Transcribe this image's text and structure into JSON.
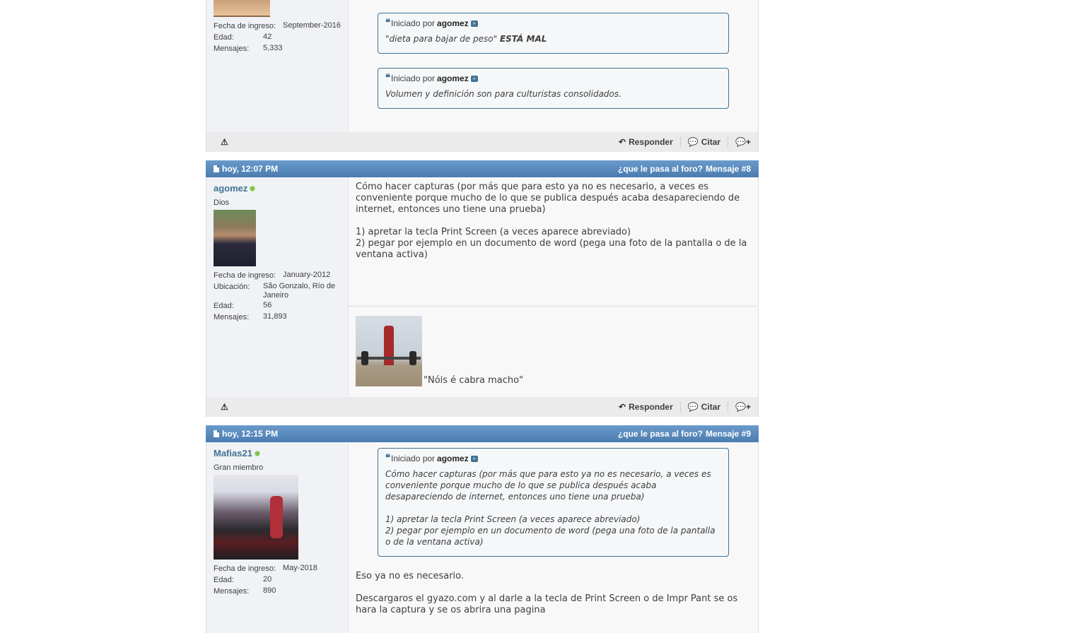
{
  "post7": {
    "user_stats": [
      {
        "label": "Fecha de ingreso:",
        "value": "September-2016"
      },
      {
        "label": "Edad:",
        "value": "42"
      },
      {
        "label": "Mensajes:",
        "value": "5,333"
      }
    ],
    "quotes": [
      {
        "prefix": "Iniciado por",
        "author": "agomez",
        "text_italic": "\"dieta para bajar de peso\" ",
        "text_bold": "ESTÁ MAL"
      },
      {
        "prefix": "Iniciado por",
        "author": "agomez",
        "text_italic": "Volumen y definición son para culturistas consolidados."
      }
    ],
    "footer": {
      "reply": "Responder",
      "quote": "Citar"
    }
  },
  "post8": {
    "date": "hoy, 12:07 PM",
    "thread_link": "¿que le pasa al foro?",
    "post_number": "Mensaje #8",
    "username": "agomez",
    "usertitle": "Dios",
    "user_stats": [
      {
        "label": "Fecha de ingreso:",
        "value": "January-2012"
      },
      {
        "label": "Ubicación:",
        "value": "São Gonzalo, Río de Janeiro"
      },
      {
        "label": "Edad:",
        "value": "56"
      },
      {
        "label": "Mensajes:",
        "value": "31,893"
      }
    ],
    "body_lines": [
      "Cómo hacer capturas (por más que para esto ya no es necesario, a veces es conveniente porque mucho de lo que se publica después acaba desapareciendo de internet, entonces uno tiene una prueba)",
      "1) apretar la tecla Print Screen (a veces aparece abreviado)",
      "2) pegar por ejemplo en un documento de word (pega una foto de la pantalla o de la ventana activa)"
    ],
    "signature": "\"Nóis é cabra macho\"",
    "footer": {
      "reply": "Responder",
      "quote": "Citar"
    }
  },
  "post9": {
    "date": "hoy, 12:15 PM",
    "thread_link": "¿que le pasa al foro?",
    "post_number": "Mensaje #9",
    "username": "Mafias21",
    "usertitle": "Gran miembro",
    "user_stats": [
      {
        "label": "Fecha de ingreso:",
        "value": "May-2018"
      },
      {
        "label": "Edad:",
        "value": "20"
      },
      {
        "label": "Mensajes:",
        "value": "890"
      }
    ],
    "quote": {
      "prefix": "Iniciado por",
      "author": "agomez",
      "lines": [
        "Cómo hacer capturas (por más que para esto ya no es necesario, a veces es conveniente porque mucho de lo que se publica después acaba desapareciendo de internet, entonces uno tiene una prueba)",
        "1) apretar la tecla Print Screen (a veces aparece abreviado)",
        "2) pegar por ejemplo en un documento de word (pega una foto de la pantalla o de la ventana activa)"
      ]
    },
    "body_lines": [
      "Eso ya no es necesario.",
      "Descargaros el gyazo.com y al darle a la tecla de Print Screen o de Impr Pant se os hara la captura y se os abrira una pagina"
    ]
  }
}
